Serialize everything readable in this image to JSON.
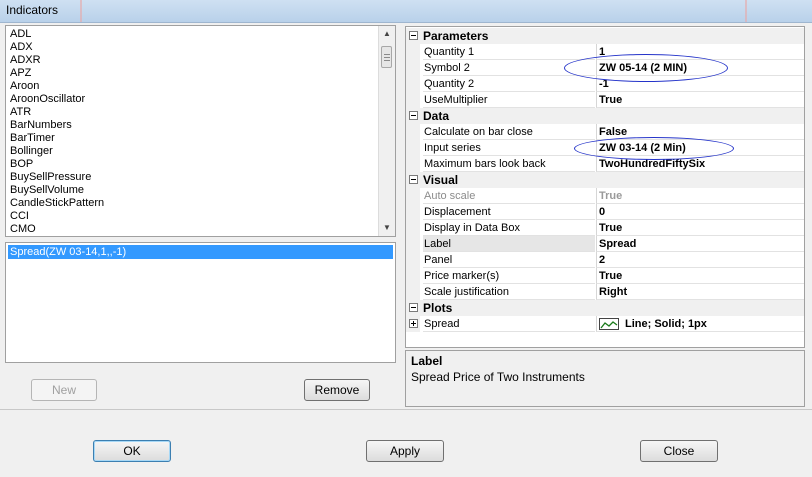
{
  "window": {
    "title": "Indicators"
  },
  "indicator_list": {
    "items": [
      "ADL",
      "ADX",
      "ADXR",
      "APZ",
      "Aroon",
      "AroonOscillator",
      "ATR",
      "BarNumbers",
      "BarTimer",
      "Bollinger",
      "BOP",
      "BuySellPressure",
      "BuySellVolume",
      "CandleStickPattern",
      "CCI",
      "CMO"
    ]
  },
  "applied_list": {
    "items": [
      "Spread(ZW 03-14,1,,-1)"
    ]
  },
  "list_buttons": {
    "new": "New",
    "remove": "Remove"
  },
  "properties": {
    "categories": [
      {
        "name": "Parameters",
        "rows": [
          {
            "label": "Quantity 1",
            "value": "1"
          },
          {
            "label": "Symbol 2",
            "value": "ZW 05-14 (2 MIN)"
          },
          {
            "label": "Quantity 2",
            "value": "-1"
          },
          {
            "label": "UseMultiplier",
            "value": "True"
          }
        ]
      },
      {
        "name": "Data",
        "rows": [
          {
            "label": "Calculate on bar close",
            "value": "False"
          },
          {
            "label": "Input series",
            "value": "ZW 03-14 (2 Min)"
          },
          {
            "label": "Maximum bars look back",
            "value": "TwoHundredFiftySix"
          }
        ]
      },
      {
        "name": "Visual",
        "rows": [
          {
            "label": "Auto scale",
            "value": "True"
          },
          {
            "label": "Displacement",
            "value": "0"
          },
          {
            "label": "Display in Data Box",
            "value": "True"
          },
          {
            "label": "Label",
            "value": "Spread"
          },
          {
            "label": "Panel",
            "value": "2"
          },
          {
            "label": "Price marker(s)",
            "value": "True"
          },
          {
            "label": "Scale justification",
            "value": "Right"
          }
        ]
      },
      {
        "name": "Plots",
        "rows": [
          {
            "label": "Spread",
            "value": "Line; Solid; 1px"
          }
        ]
      }
    ]
  },
  "description": {
    "title": "Label",
    "text": "Spread Price of Two Instruments"
  },
  "dialog_buttons": {
    "ok": "OK",
    "apply": "Apply",
    "close": "Close"
  },
  "colors": {
    "selection": "#3399ff",
    "annotation_ellipse": "#2433c9",
    "plot_line": "#1a7a1a"
  }
}
